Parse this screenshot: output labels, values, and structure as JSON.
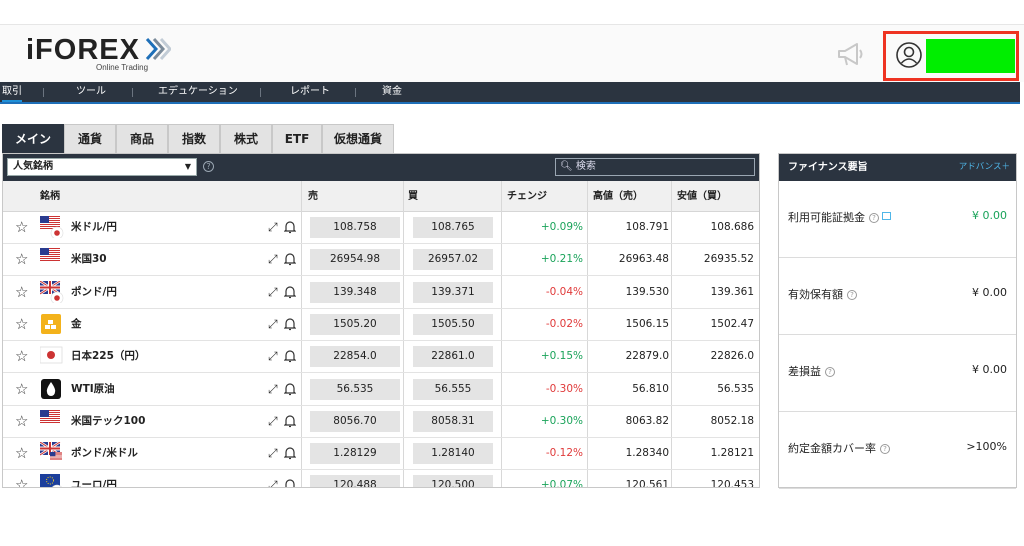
{
  "brand": {
    "name": "iFOREX",
    "tagline": "Online Trading"
  },
  "nav": {
    "items": [
      "取引",
      "ツール",
      "エデュケーション",
      "レポート",
      "資金"
    ]
  },
  "tabs": [
    "メイン",
    "通貨",
    "商品",
    "指数",
    "株式",
    "ETF",
    "仮想通貨"
  ],
  "filter": {
    "selected": "人気銘柄",
    "search_placeholder": "検索"
  },
  "table": {
    "headers": {
      "instrument": "銘柄",
      "sell": "売",
      "buy": "買",
      "change": "チェンジ",
      "high": "高値（売）",
      "low": "安値（買）"
    },
    "rows": [
      {
        "name": "米ドル/円",
        "flag": "us-jp",
        "sell": "108.758",
        "buy": "108.765",
        "change": "+0.09%",
        "direction": "up",
        "high": "108.791",
        "low": "108.686"
      },
      {
        "name": "米国30",
        "flag": "us",
        "sell": "26954.98",
        "buy": "26957.02",
        "change": "+0.21%",
        "direction": "up",
        "high": "26963.48",
        "low": "26935.52"
      },
      {
        "name": "ポンド/円",
        "flag": "gb-jp",
        "sell": "139.348",
        "buy": "139.371",
        "change": "-0.04%",
        "direction": "down",
        "high": "139.530",
        "low": "139.361"
      },
      {
        "name": "金",
        "flag": "gold",
        "sell": "1505.20",
        "buy": "1505.50",
        "change": "-0.02%",
        "direction": "down",
        "high": "1506.15",
        "low": "1502.47"
      },
      {
        "name": "日本225（円）",
        "flag": "jp",
        "sell": "22854.0",
        "buy": "22861.0",
        "change": "+0.15%",
        "direction": "up",
        "high": "22879.0",
        "low": "22826.0"
      },
      {
        "name": "WTI原油",
        "flag": "oil",
        "sell": "56.535",
        "buy": "56.555",
        "change": "-0.30%",
        "direction": "down",
        "high": "56.810",
        "low": "56.535"
      },
      {
        "name": "米国テック100",
        "flag": "us",
        "sell": "8056.70",
        "buy": "8058.31",
        "change": "+0.30%",
        "direction": "up",
        "high": "8063.82",
        "low": "8052.18"
      },
      {
        "name": "ポンド/米ドル",
        "flag": "gb-us",
        "sell": "1.28129",
        "buy": "1.28140",
        "change": "-0.12%",
        "direction": "down",
        "high": "1.28340",
        "low": "1.28121"
      },
      {
        "name": "ユーロ/円",
        "flag": "eu-jp",
        "sell": "120.488",
        "buy": "120.500",
        "change": "+0.07%",
        "direction": "up",
        "high": "120.561",
        "low": "120.453"
      }
    ]
  },
  "finance": {
    "title": "ファイナンス要旨",
    "advanced_label": "アドバンス＋",
    "items": [
      {
        "label": "利用可能証拠金",
        "value": "¥ 0.00",
        "green": true,
        "external": true
      },
      {
        "label": "有効保有額",
        "value": "¥ 0.00",
        "green": false,
        "external": false
      },
      {
        "label": "差損益",
        "value": "¥ 0.00",
        "green": false,
        "external": false
      },
      {
        "label": "約定金額カバー率",
        "value": ">100%",
        "green": false,
        "external": false
      }
    ]
  },
  "colors": {
    "nav_bg": "#2b3440",
    "up": "#1aa35a",
    "down": "#e03a3a",
    "highlight": "#ee3322",
    "redacted": "#00ee00"
  }
}
